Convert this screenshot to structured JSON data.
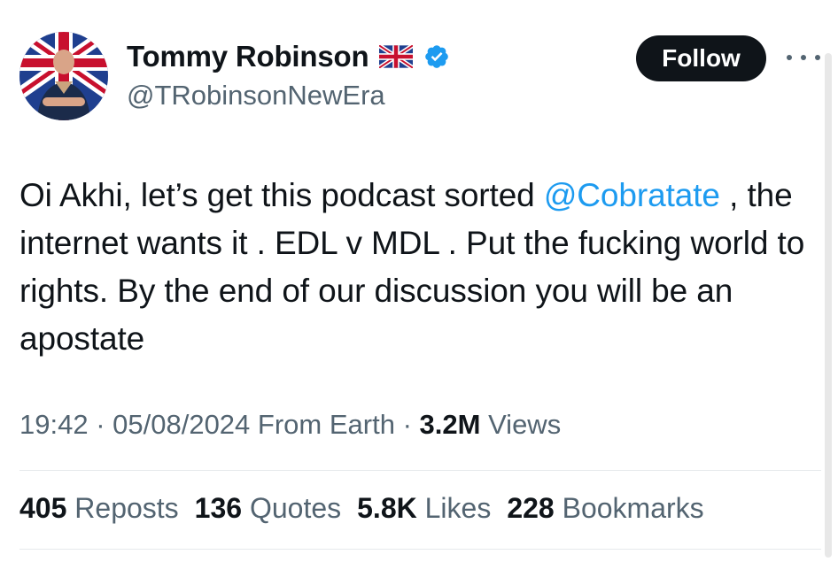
{
  "author": {
    "display_name": "Tommy Robinson",
    "handle": "@TRobinsonNewEra",
    "flag": "uk-flag-icon",
    "verified": true
  },
  "actions": {
    "follow_label": "Follow"
  },
  "tweet": {
    "text_before": "Oi Akhi, let’s get this podcast sorted ",
    "mention": "@Cobratate",
    "text_after": " , the internet wants it . EDL v MDL . Put the fucking world to rights. By the end of our discussion you will be an apostate"
  },
  "meta": {
    "time": "19:42",
    "date": "05/08/2024",
    "source": "From Earth",
    "views_count": "3.2M",
    "views_label": "Views"
  },
  "stats": [
    {
      "count": "405",
      "label": "Reposts"
    },
    {
      "count": "136",
      "label": "Quotes"
    },
    {
      "count": "5.8K",
      "label": "Likes"
    },
    {
      "count": "228",
      "label": "Bookmarks"
    }
  ],
  "colors": {
    "accent": "#1d9bf0",
    "text": "#0f1419",
    "secondary": "#536471",
    "follow_bg": "#0f1419"
  }
}
